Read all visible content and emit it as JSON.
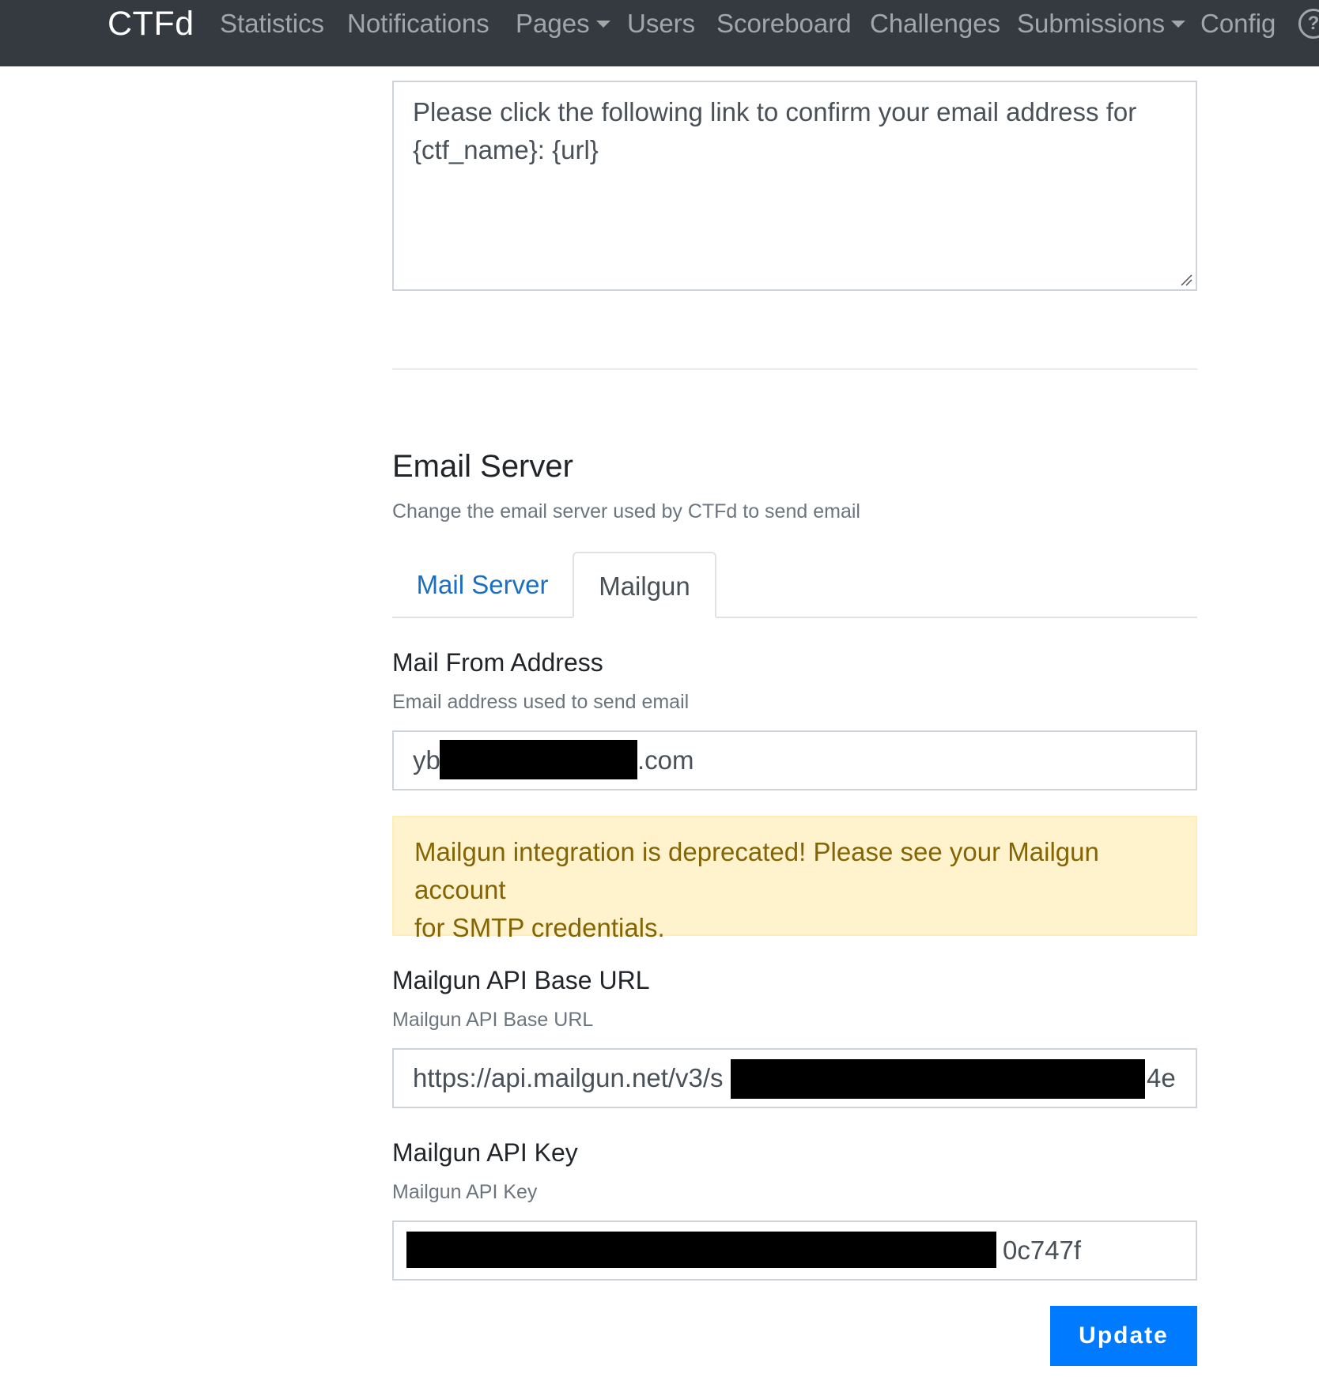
{
  "navbar": {
    "brand": "CTFd",
    "items": [
      {
        "label": "Statistics"
      },
      {
        "label": "Notifications"
      },
      {
        "label": "Pages"
      },
      {
        "label": "Users"
      },
      {
        "label": "Scoreboard"
      },
      {
        "label": "Challenges"
      },
      {
        "label": "Submissions"
      },
      {
        "label": "Config"
      }
    ],
    "help_icon": "question-circle-icon"
  },
  "confirmation_email": {
    "body_line1": "Please click the following link to confirm your email address for",
    "body_line2": "{ctf_name}: {url}"
  },
  "email_server": {
    "title": "Email Server",
    "subtitle": "Change the email server used by CTFd to send email",
    "tabs": [
      {
        "label": "Mail Server",
        "active": false
      },
      {
        "label": "Mailgun",
        "active": true
      }
    ]
  },
  "mailgun_form": {
    "from_address": {
      "label": "Mail From Address",
      "help": "Email address used to send email",
      "value_prefix": "yb",
      "value_suffix": ".com"
    },
    "alert": {
      "line1": "Mailgun integration is deprecated! Please see your Mailgun account",
      "line2": "for SMTP credentials."
    },
    "base_url": {
      "label": "Mailgun API Base URL",
      "help": "Mailgun API Base URL",
      "value_prefix": "https://api.mailgun.net/v3/s",
      "value_suffix": "4e"
    },
    "api_key": {
      "label": "Mailgun API Key",
      "help": "Mailgun API Key",
      "value_suffix": "0c747f"
    }
  },
  "actions": {
    "update_label": "Update"
  },
  "colors": {
    "navbar_bg": "#343a40",
    "link_blue": "#1a6fc1",
    "primary": "#007bff",
    "alert_bg": "#fff3cd",
    "alert_text": "#856404"
  }
}
